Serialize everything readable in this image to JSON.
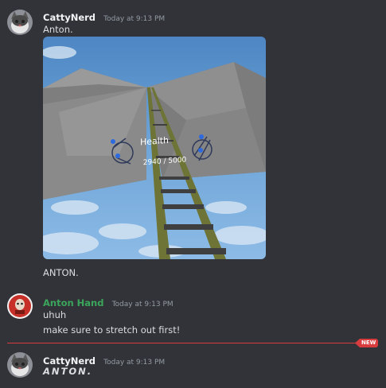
{
  "messages": [
    {
      "username": "CattyNerd",
      "name_color": "#f2f3f5",
      "timestamp": "Today at 9:13 PM",
      "lines": [
        "Anton.",
        "ANTON."
      ],
      "attachment": {
        "hud_label": "Health",
        "hud_value": "2940 / 5000"
      }
    },
    {
      "username": "Anton Hand",
      "name_color": "#3ba55c",
      "timestamp": "Today at 9:13 PM",
      "lines": [
        "uhuh",
        "make sure to stretch out first!"
      ]
    },
    {
      "username": "CattyNerd",
      "name_color": "#f2f3f5",
      "timestamp": "Today at 9:13 PM",
      "lines": [
        "ANTON."
      ]
    }
  ],
  "new_divider": {
    "label": "NEW",
    "color": "#d83c3e"
  }
}
